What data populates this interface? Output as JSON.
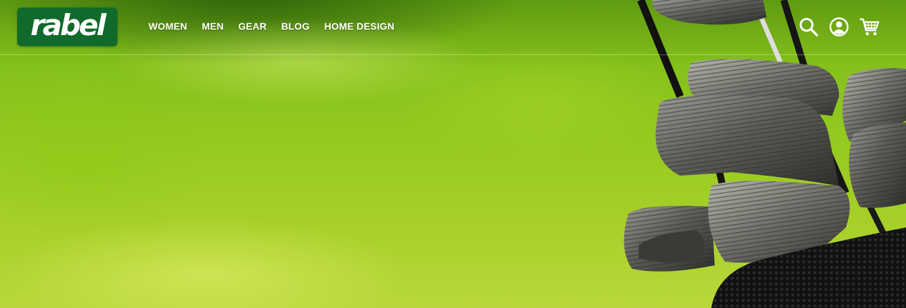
{
  "brand": {
    "logo_text": "rabel",
    "logo_bg": "#0f6a2b"
  },
  "nav": {
    "items": [
      {
        "label": "WOMEN"
      },
      {
        "label": "MEN"
      },
      {
        "label": "GEAR"
      },
      {
        "label": "BLOG"
      },
      {
        "label": "HOME DESIGN"
      }
    ]
  },
  "header_icons": [
    {
      "name": "search-icon"
    },
    {
      "name": "account-icon"
    },
    {
      "name": "cart-icon"
    }
  ],
  "hero": {
    "image_subject": "golf-clubs-in-bag",
    "background_color": "#95c91f"
  }
}
